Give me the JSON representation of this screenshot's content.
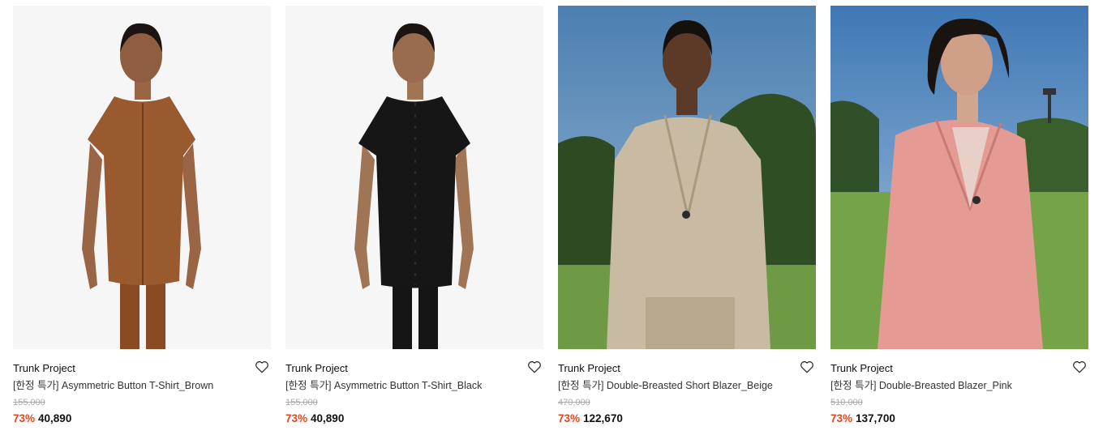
{
  "colors": {
    "discount": "#e4471c",
    "original_price": "#aaaaaa",
    "studio_bg": "#f6f6f6",
    "sky": "#5c8ab8",
    "grass": "#6f9a45"
  },
  "products": [
    {
      "brand": "Trunk Project",
      "name": "[한정 특가] Asymmetric Button T-Shirt_Brown",
      "original_price": "155,000",
      "discount": "73%",
      "price": "40,890",
      "wishlist_icon": "heart-outline-icon"
    },
    {
      "brand": "Trunk Project",
      "name": "[한정 특가] Asymmetric Button T-Shirt_Black",
      "original_price": "155,000",
      "discount": "73%",
      "price": "40,890",
      "wishlist_icon": "heart-outline-icon"
    },
    {
      "brand": "Trunk Project",
      "name": "[한정 특가] Double-Breasted Short Blazer_Beige",
      "original_price": "470,000",
      "discount": "73%",
      "price": "122,670",
      "wishlist_icon": "heart-outline-icon"
    },
    {
      "brand": "Trunk Project",
      "name": "[한정 특가] Double-Breasted Blazer_Pink",
      "original_price": "510,000",
      "discount": "73%",
      "price": "137,700",
      "wishlist_icon": "heart-outline-icon"
    }
  ]
}
